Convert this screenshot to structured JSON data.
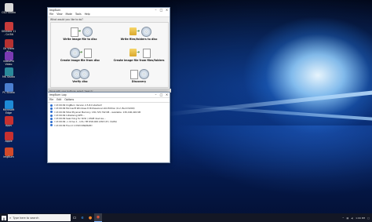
{
  "desktop": {
    "icons": [
      {
        "label": "CSD Studio",
        "color": "#d9d9d9"
      },
      {
        "label": "OKVideo 11 - Cd Bit",
        "color": "#c83b3b"
      },
      {
        "label": "Ok Video Win",
        "color": "#b53131"
      },
      {
        "label": "videoPro Video",
        "color": "#7a3ab3"
      },
      {
        "label": "MK Studio",
        "color": "#2a8a9b"
      },
      {
        "label": "PC Studio",
        "color": "#4b7fd0"
      },
      {
        "label": "Microsoft Edge",
        "color": "#1e8ad6"
      },
      {
        "label": "Apps",
        "color": "#c73030"
      },
      {
        "label": "Apple",
        "color": "#c73030"
      },
      {
        "label": "ImgBurn",
        "color": "#d24a2a"
      }
    ]
  },
  "imgburn": {
    "title": "ImgBurn",
    "menu": [
      "File",
      "View",
      "Mode",
      "Tools",
      "Help"
    ],
    "prompt": "What would you like to do?",
    "modes": [
      {
        "label": "Write image file to disc",
        "icon": "disc-write-icon"
      },
      {
        "label": "Write files/folders to disc",
        "icon": "folder-write-icon"
      },
      {
        "label": "Create image file from disc",
        "icon": "disc-read-icon"
      },
      {
        "label": "Create image file from files/folders",
        "icon": "folder-image-icon"
      },
      {
        "label": "Verify disc",
        "icon": "verify-icon"
      },
      {
        "label": "Discovery",
        "icon": "discovery-icon"
      }
    ],
    "status": "Move with your buttons; select ‘Search’"
  },
  "log": {
    "title": "ImgBurn Log",
    "menu": [
      "File",
      "Edit",
      "Options"
    ],
    "lines": [
      "I 13:09:09 ImgBurn Version 2.5.8.0 started!",
      "I 13:09:09 Microsoft Windows 8 Professional x64 Edition (6.2, Build 9200)",
      "I 13:09:09 Total Physical Memory: 130,723,792 KB - Available: 130,196,492 KB",
      "I 13:09:09 Initialising SPTI...",
      "I 13:09:09 Searching for SCSI / ATAPI devices...",
      "I 13:09:09 -> Drive 1 - Info: HP DVD-RW  AH15 (E:) (SATA)",
      "I 13:09:09 Found 1 DVD±RW/RAM!"
    ]
  },
  "taskbar": {
    "search_placeholder": "Type here to search",
    "apps": [
      "task-view-icon",
      "edge-icon",
      "firefox-icon",
      "imgburn-icon"
    ],
    "tray_time": "1:09 PM"
  }
}
